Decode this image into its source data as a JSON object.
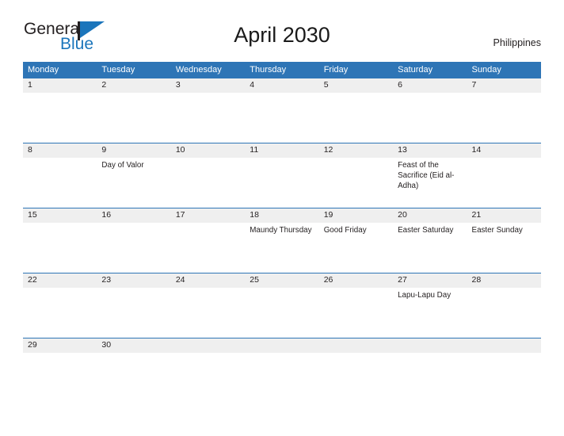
{
  "brand": {
    "name_part1": "General",
    "name_part2": "Blue",
    "flag_icon": "flag-icon",
    "accent_color": "#1b75bb"
  },
  "header": {
    "title": "April 2030",
    "country": "Philippines"
  },
  "theme": {
    "header_blue": "#2e75b6",
    "date_band_gray": "#efefef",
    "text_dark": "#231f20"
  },
  "calendar": {
    "month": "April",
    "year": "2030",
    "weekday_headers": [
      "Monday",
      "Tuesday",
      "Wednesday",
      "Thursday",
      "Friday",
      "Saturday",
      "Sunday"
    ],
    "weeks": [
      [
        {
          "day": "1",
          "event": ""
        },
        {
          "day": "2",
          "event": ""
        },
        {
          "day": "3",
          "event": ""
        },
        {
          "day": "4",
          "event": ""
        },
        {
          "day": "5",
          "event": ""
        },
        {
          "day": "6",
          "event": ""
        },
        {
          "day": "7",
          "event": ""
        }
      ],
      [
        {
          "day": "8",
          "event": ""
        },
        {
          "day": "9",
          "event": "Day of Valor"
        },
        {
          "day": "10",
          "event": ""
        },
        {
          "day": "11",
          "event": ""
        },
        {
          "day": "12",
          "event": ""
        },
        {
          "day": "13",
          "event": "Feast of the Sacrifice (Eid al-Adha)"
        },
        {
          "day": "14",
          "event": ""
        }
      ],
      [
        {
          "day": "15",
          "event": ""
        },
        {
          "day": "16",
          "event": ""
        },
        {
          "day": "17",
          "event": ""
        },
        {
          "day": "18",
          "event": "Maundy Thursday"
        },
        {
          "day": "19",
          "event": "Good Friday"
        },
        {
          "day": "20",
          "event": "Easter Saturday"
        },
        {
          "day": "21",
          "event": "Easter Sunday"
        }
      ],
      [
        {
          "day": "22",
          "event": ""
        },
        {
          "day": "23",
          "event": ""
        },
        {
          "day": "24",
          "event": ""
        },
        {
          "day": "25",
          "event": ""
        },
        {
          "day": "26",
          "event": ""
        },
        {
          "day": "27",
          "event": "Lapu-Lapu Day"
        },
        {
          "day": "28",
          "event": ""
        }
      ],
      [
        {
          "day": "29",
          "event": ""
        },
        {
          "day": "30",
          "event": ""
        },
        {
          "day": "",
          "event": ""
        },
        {
          "day": "",
          "event": ""
        },
        {
          "day": "",
          "event": ""
        },
        {
          "day": "",
          "event": ""
        },
        {
          "day": "",
          "event": ""
        }
      ]
    ]
  }
}
